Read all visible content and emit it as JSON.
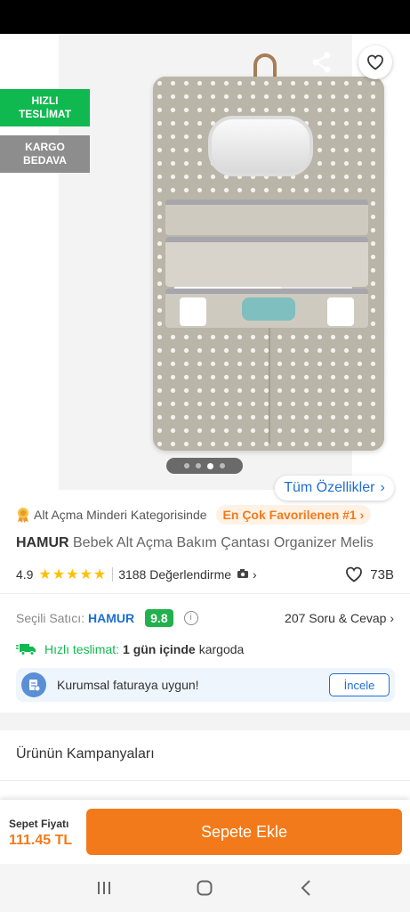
{
  "badges": {
    "fast_delivery": "HIZLI TESLİMAT",
    "free_cargo": "KARGO BEDAVA"
  },
  "gallery": {
    "total_images": 4,
    "active_index": 2
  },
  "all_specs_label": "Tüm Özellikler",
  "category": {
    "text": "Alt Açma Minderi Kategorisinde",
    "chip": "En Çok Favorilenen #1"
  },
  "product": {
    "brand": "HAMUR",
    "name": "Bebek Alt Açma Bakım Çantası Organizer Melis"
  },
  "rating": {
    "score": "4.9",
    "stars": "★★★★★",
    "review_count": "3188 Değerlendirme",
    "favorites": "73B"
  },
  "seller": {
    "label": "Seçili Satıcı:",
    "name": "HAMUR",
    "score": "9.8",
    "qa": "207 Soru & Cevap"
  },
  "shipping": {
    "label": "Hızlı teslimat:",
    "time": "1 gün içinde",
    "suffix": "kargoda"
  },
  "invoice": {
    "text": "Kurumsal faturaya uygun!",
    "button": "İncele"
  },
  "campaigns_title": "Ürünün Kampanyaları",
  "cart": {
    "price_label": "Sepet Fiyatı",
    "price": "111.45 TL",
    "button": "Sepete Ekle"
  },
  "colors": {
    "accent": "#f27a1a",
    "link": "#1f6fd1",
    "success": "#10b94f"
  }
}
